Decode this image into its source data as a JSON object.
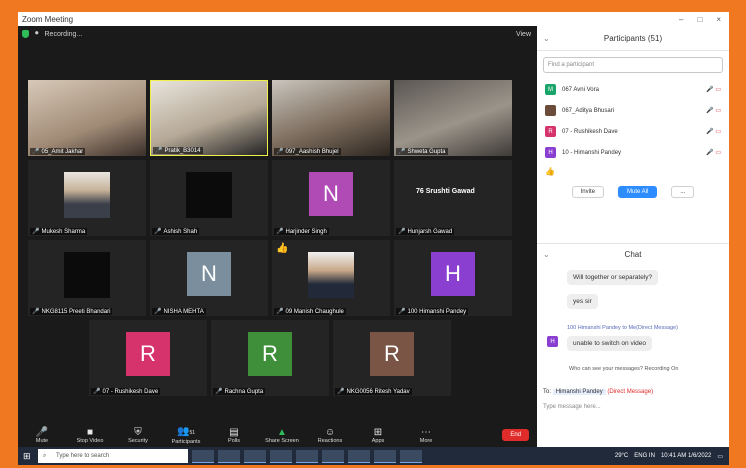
{
  "window": {
    "title": "Zoom Meeting",
    "controls": [
      "–",
      "□",
      "×"
    ]
  },
  "meeting": {
    "status": "Recording...",
    "view_label": "View"
  },
  "tiles": [
    {
      "name": "05_Amit Jakhar"
    },
    {
      "name": "Pratik_B3014"
    },
    {
      "name": "097_Aashish Bhujel"
    },
    {
      "name": "Shweta Gupta"
    },
    {
      "name": "Mukesh Sharma"
    },
    {
      "name": "Ashish Shah"
    },
    {
      "name": "Harjinder Singh",
      "letter": "N"
    },
    {
      "name": "Hunjarsh Gawad",
      "caption": "76 Srushti Gawad"
    },
    {
      "name": "NKG8115 Preeti Bhandari"
    },
    {
      "name": "NISHA MEHTA",
      "letter": "N"
    },
    {
      "name": "09 Manish Chaughule"
    },
    {
      "name": "100 Himanshi Pandey",
      "letter": "H"
    },
    {
      "name": "07 - Rushikesh Dave",
      "letter": "R"
    },
    {
      "name": "Rachna Gupta",
      "letter": "R"
    },
    {
      "name": "NKG0056 Ritesh Yadav",
      "letter": "R"
    }
  ],
  "toolbar": [
    {
      "label": "Mute",
      "icon": "🎤"
    },
    {
      "label": "Stop Video",
      "icon": "■"
    },
    {
      "label": "Security",
      "icon": "⛨"
    },
    {
      "label": "Participants",
      "icon": "👥",
      "count": "51"
    },
    {
      "label": "Polls",
      "icon": "▤"
    },
    {
      "label": "Share Screen",
      "icon": "▲"
    },
    {
      "label": "Reactions",
      "icon": "☺"
    },
    {
      "label": "Apps",
      "icon": "⊞"
    },
    {
      "label": "More",
      "icon": "⋯"
    }
  ],
  "end_label": "End",
  "participants": {
    "title": "Participants (51)",
    "search_placeholder": "Find a participant",
    "list": [
      {
        "name": "067 Avni Vora",
        "initial": "M",
        "color": "#19a46a"
      },
      {
        "name": "067_Aditya Bhusari",
        "initial": "",
        "color": "#6b4b3a"
      },
      {
        "name": "07 - Rushikesh Dave",
        "initial": "R",
        "color": "#d6336c"
      },
      {
        "name": "10 - Himanshi Pandey",
        "initial": "H",
        "color": "#8b3fd1"
      }
    ],
    "invite_label": "Invite",
    "mute_all_label": "Mute All",
    "more_label": "..."
  },
  "chat": {
    "title": "Chat",
    "messages": [
      "Will together or separately?",
      "yes sir"
    ],
    "dm_notice": "100 Himanshi Pandey to Me(Direct Message)",
    "dm_initial": "H",
    "dm_text": "unable to switch on video",
    "recording_note": "Who can see your messages? Recording On",
    "to_label": "To:",
    "to_name": "Himanshi Pandey",
    "dm_tag": "(Direct Message)",
    "compose_placeholder": "Type message here..."
  },
  "taskbar": {
    "search_placeholder": "Type here to search",
    "apps": [
      "Zoom",
      "Chrome",
      "Explorer",
      "Edge",
      "Word",
      "Teams",
      "Mail",
      "PowerPoint",
      "Zoom"
    ],
    "weather": "29°C",
    "lang": "ENG IN",
    "time": "10:41 AM",
    "date": "1/6/2022"
  },
  "colors": {
    "frame": "#f07820",
    "recording": "#e02b2b",
    "accent": "#2d8cff"
  }
}
